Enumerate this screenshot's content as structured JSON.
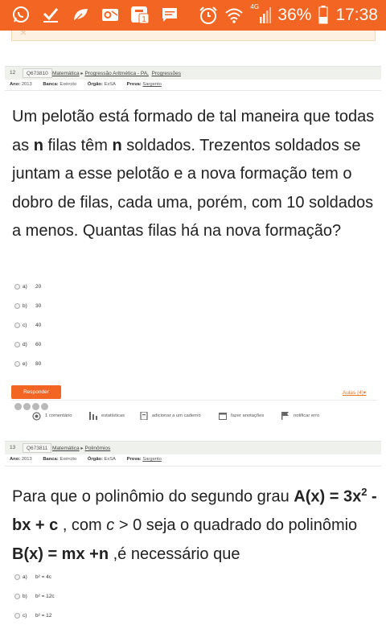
{
  "status_bar": {
    "battery": "36%",
    "time": "17:38",
    "network": "4G",
    "icons": [
      "whatsapp-icon",
      "checkmark-icon",
      "leaf-icon",
      "outlook-icon",
      "notification-icon",
      "message-icon",
      "alarm-icon",
      "wifi-icon",
      "signal-icon",
      "battery-icon"
    ],
    "notification_count": "1",
    "accent": "#f26522"
  },
  "prev_notice": {
    "close": "×"
  },
  "q1": {
    "number": "12",
    "id": "Q673810",
    "crumb_subject": "Matemática",
    "crumb_topic": "Progressão Aritmética - PA,",
    "crumb_sub": "Progressões",
    "meta": {
      "ano_label": "Ano:",
      "ano": "2013",
      "banca_label": "Banca:",
      "banca": "Exército",
      "orgao_label": "Órgão:",
      "orgao": "ExSA",
      "prova_label": "Prova:",
      "prova": "Sargento"
    },
    "text": {
      "p1": "Um pelotão está formado de tal maneira que todas as ",
      "n1": "n",
      "p2": " filas têm ",
      "n2": "n",
      "p3": " soldados. Trezentos soldados se juntam a esse pelotão e a nova formação tem o dobro de filas, cada uma, porém, com 10 soldados a menos. Quantas filas há na nova formação?"
    },
    "options": [
      {
        "letter": "a)",
        "text": "20"
      },
      {
        "letter": "b)",
        "text": "30"
      },
      {
        "letter": "c)",
        "text": "40"
      },
      {
        "letter": "d)",
        "text": "60"
      },
      {
        "letter": "e)",
        "text": "80"
      }
    ],
    "answer_button": "Responder",
    "aulas_link": "Aulas (4)▾",
    "tools": {
      "comentario": "1 comentário",
      "estatisticas": "estatísticas",
      "caderno": "adicionar a um caderno",
      "anotacoes": "fazer anotações",
      "erro": "notificar erro"
    }
  },
  "q2": {
    "number": "13",
    "id": "Q673811",
    "crumb_subject": "Matemática",
    "crumb_topic": "Polinômios",
    "meta": {
      "ano_label": "Ano:",
      "ano": "2013",
      "banca_label": "Banca:",
      "banca": "Exército",
      "orgao_label": "Órgão:",
      "orgao": "ExSA",
      "prova_label": "Prova:",
      "prova": "Sargento"
    },
    "text": {
      "p1": "Para que o polinômio do segundo grau ",
      "ax": "A(x) = 3x",
      "sup": "2",
      "ax2": " - bx + c",
      "p2": " , com ",
      "c": "c",
      "p3": " > 0 seja o quadrado do polinômio ",
      "bx": "B(x) = mx +n",
      "p4": " ,é necessário que"
    },
    "options": [
      {
        "letter": "a)",
        "text": "b² = 4c"
      },
      {
        "letter": "b)",
        "text": "b² = 12c"
      },
      {
        "letter": "c)",
        "text": "b² = 12"
      }
    ]
  }
}
